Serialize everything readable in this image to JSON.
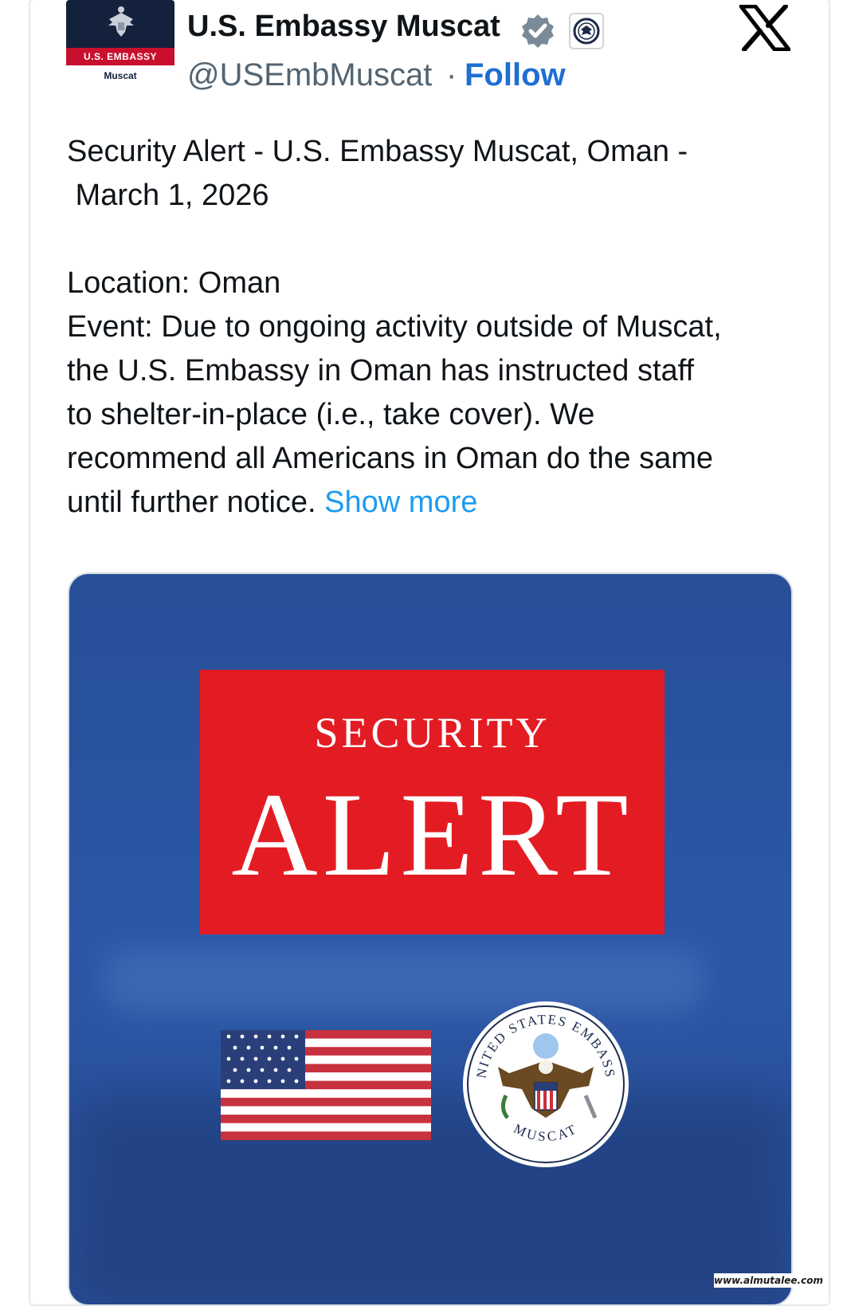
{
  "account": {
    "avatar_label": "U.S. EMBASSY",
    "avatar_city": "Muscat",
    "name": "U.S. Embassy Muscat",
    "handle": "@USEmbMuscat",
    "separator": "·",
    "follow_label": "Follow"
  },
  "post": {
    "lines": [
      "Security Alert - U.S. Embassy Muscat, Oman -",
      " March 1, 2026",
      "Location: Oman",
      "Event: Due to ongoing activity outside of Muscat,",
      "the U.S. Embassy in Oman has instructed staff",
      "to shelter-in-place (i.e., take cover). We",
      "recommend all Americans in Oman do the same",
      "until further notice."
    ],
    "show_more": "Show more"
  },
  "media": {
    "alert_line1": "SECURITY",
    "alert_line2": "ALERT",
    "seal_top_text": "UNITED STATES EMBASSY",
    "seal_bottom_text": "MUSCAT"
  },
  "watermark": "www.almutalee.com",
  "icons": {
    "verified": "verified-badge-icon",
    "affiliation": "state-department-seal-icon",
    "platform": "x-logo-icon"
  },
  "colors": {
    "follow": "#1d6fd4",
    "show_more": "#1d9bf0",
    "alert_red": "#e31c24",
    "media_blue": "#2b57a6",
    "verified": "#7a8a99"
  }
}
